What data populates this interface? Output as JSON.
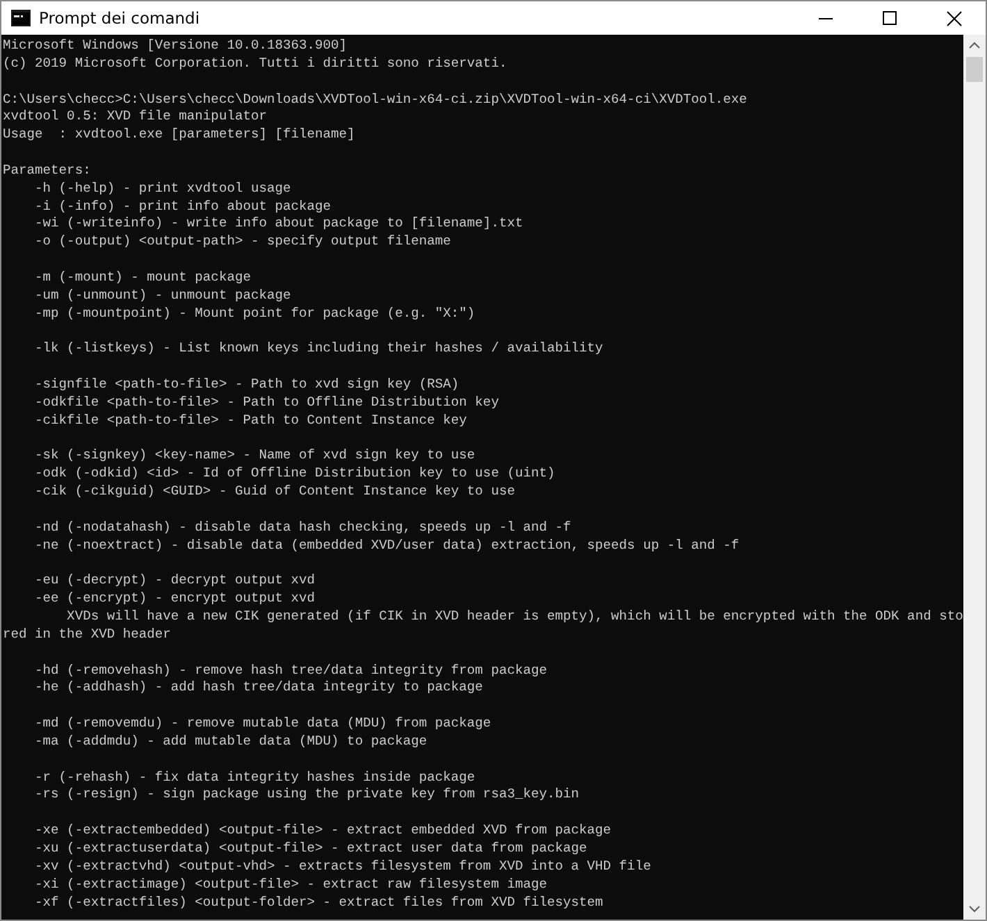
{
  "window": {
    "title": "Prompt dei comandi"
  },
  "console": {
    "blocks": [
      [
        "Microsoft Windows [Versione 10.0.18363.900]",
        "(c) 2019 Microsoft Corporation. Tutti i diritti sono riservati."
      ],
      [
        "C:\\Users\\checc>C:\\Users\\checc\\Downloads\\XVDTool-win-x64-ci.zip\\XVDTool-win-x64-ci\\XVDTool.exe",
        "xvdtool 0.5: XVD file manipulator",
        "Usage  : xvdtool.exe [parameters] [filename]"
      ],
      [
        "Parameters:",
        "    -h (-help) - print xvdtool usage",
        "    -i (-info) - print info about package",
        "    -wi (-writeinfo) - write info about package to [filename].txt",
        "    -o (-output) <output-path> - specify output filename"
      ],
      [
        "    -m (-mount) - mount package",
        "    -um (-unmount) - unmount package",
        "    -mp (-mountpoint) - Mount point for package (e.g. \"X:\")"
      ],
      [
        "    -lk (-listkeys) - List known keys including their hashes / availability"
      ],
      [
        "    -signfile <path-to-file> - Path to xvd sign key (RSA)",
        "    -odkfile <path-to-file> - Path to Offline Distribution key",
        "    -cikfile <path-to-file> - Path to Content Instance key"
      ],
      [
        "    -sk (-signkey) <key-name> - Name of xvd sign key to use",
        "    -odk (-odkid) <id> - Id of Offline Distribution key to use (uint)",
        "    -cik (-cikguid) <GUID> - Guid of Content Instance key to use"
      ],
      [
        "    -nd (-nodatahash) - disable data hash checking, speeds up -l and -f",
        "    -ne (-noextract) - disable data (embedded XVD/user data) extraction, speeds up -l and -f"
      ],
      [
        "    -eu (-decrypt) - decrypt output xvd",
        "    -ee (-encrypt) - encrypt output xvd",
        "        XVDs will have a new CIK generated (if CIK in XVD header is empty), which will be encrypted with the ODK and sto",
        "red in the XVD header"
      ],
      [
        "    -hd (-removehash) - remove hash tree/data integrity from package",
        "    -he (-addhash) - add hash tree/data integrity to package"
      ],
      [
        "    -md (-removemdu) - remove mutable data (MDU) from package",
        "    -ma (-addmdu) - add mutable data (MDU) to package"
      ],
      [
        "    -r (-rehash) - fix data integrity hashes inside package",
        "    -rs (-resign) - sign package using the private key from rsa3_key.bin"
      ],
      [
        "    -xe (-extractembedded) <output-file> - extract embedded XVD from package",
        "    -xu (-extractuserdata) <output-file> - extract user data from package",
        "    -xv (-extractvhd) <output-vhd> - extracts filesystem from XVD into a VHD file",
        "    -xi (-extractimage) <output-file> - extract raw filesystem image",
        "    -xf (-extractfiles) <output-folder> - extract files from XVD filesystem"
      ]
    ]
  }
}
